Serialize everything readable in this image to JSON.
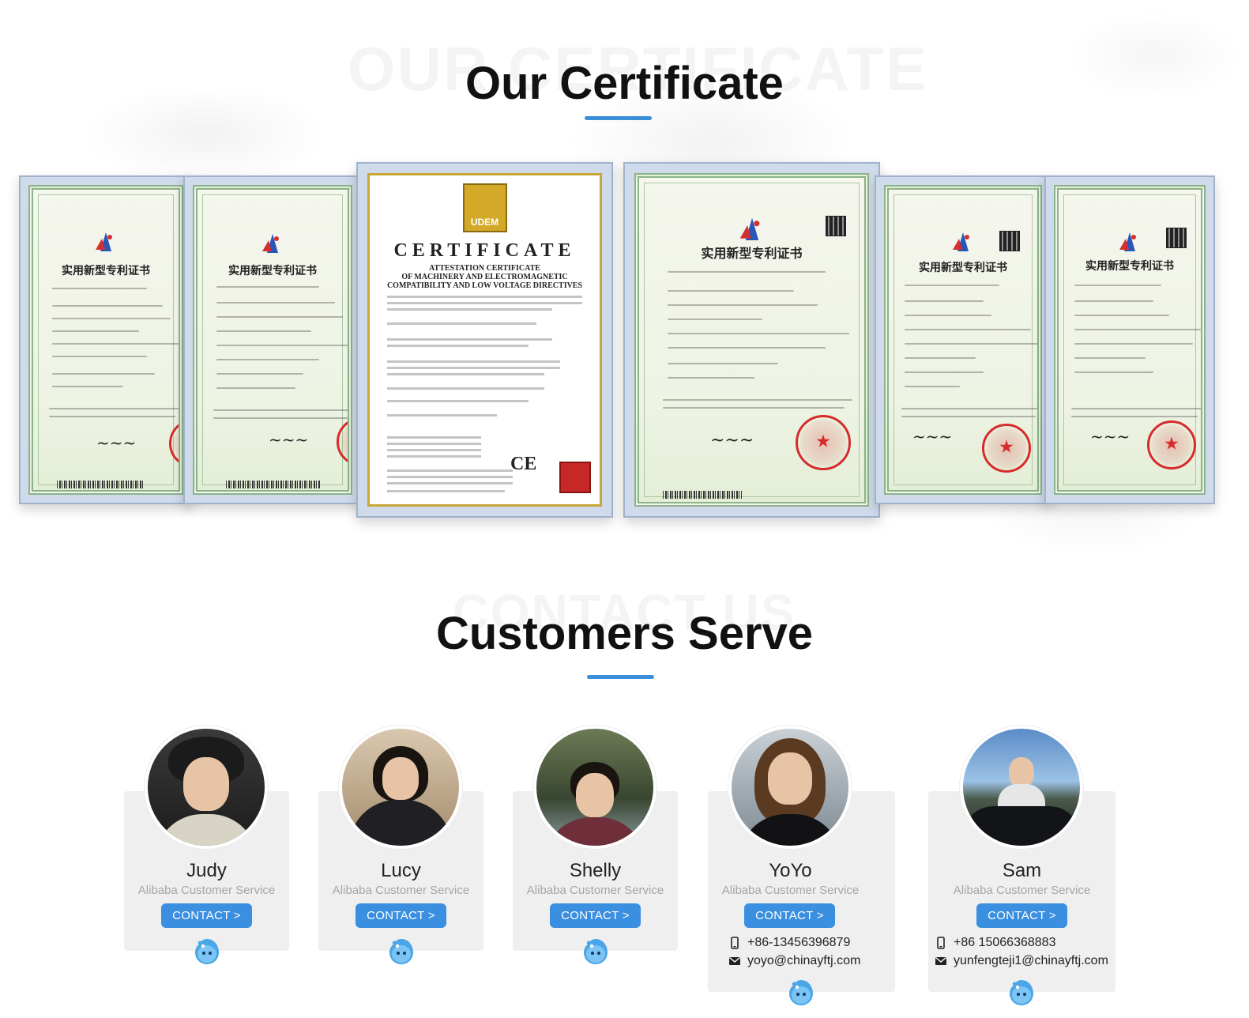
{
  "certificate_section": {
    "title": "Our Certificate",
    "watermark": "OUR CERTIFICATE",
    "certificates": [
      {
        "title": "实用新型专利证书"
      },
      {
        "title": "实用新型专利证书"
      },
      {
        "title": "CERTIFICATE",
        "subtitle_1": "ATTESTATION CERTIFICATE",
        "subtitle_2": "OF MACHINERY AND ELECTROMAGNETIC",
        "subtitle_3": "COMPATIBILITY AND LOW VOLTAGE DIRECTIVES",
        "logo_text": "UDEM",
        "mark": "CE"
      },
      {
        "title": "实用新型专利证书"
      },
      {
        "title": "实用新型专利证书"
      },
      {
        "title": "实用新型专利证书"
      }
    ]
  },
  "customers_section": {
    "title": "Customers Serve",
    "watermark": "CONTACT US",
    "members": [
      {
        "name": "Judy",
        "role": "Alibaba Customer Service",
        "button": "CONTACT >"
      },
      {
        "name": "Lucy",
        "role": "Alibaba Customer Service",
        "button": "CONTACT >"
      },
      {
        "name": "Shelly",
        "role": "Alibaba Customer Service",
        "button": "CONTACT >"
      },
      {
        "name": "YoYo",
        "role": "Alibaba Customer Service",
        "button": "CONTACT >",
        "phone": "+86-13456396879",
        "email": "yoyo@chinayftj.com"
      },
      {
        "name": "Sam",
        "role": "Alibaba Customer Service",
        "button": "CONTACT >",
        "phone": "+86 15066368883",
        "email": "yunfengteji1@chinayftj.com"
      }
    ]
  },
  "colors": {
    "accent": "#3a8fe0",
    "card_bg": "#efefef",
    "role_text": "#a5a5a5"
  },
  "icons": [
    "qq-icon",
    "phone-icon",
    "mail-icon",
    "cnipa-logo-icon",
    "udem-logo-icon"
  ]
}
